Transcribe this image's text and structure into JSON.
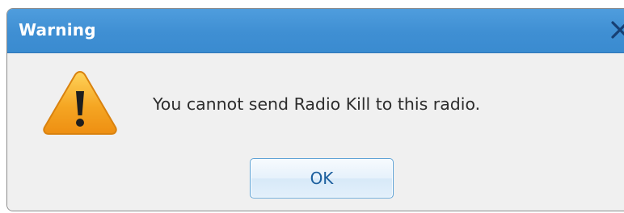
{
  "dialog": {
    "title": "Warning",
    "message": "You cannot send Radio Kill to this radio.",
    "ok_label": "OK",
    "icons": {
      "close": "close-icon",
      "warning": "warning-icon"
    },
    "colors": {
      "titlebar": "#3f8fd3",
      "title_text": "#ffffff",
      "close_icon": "#173f73",
      "warning_fill": "#f2a21a",
      "button_text": "#1c5f9e"
    }
  }
}
